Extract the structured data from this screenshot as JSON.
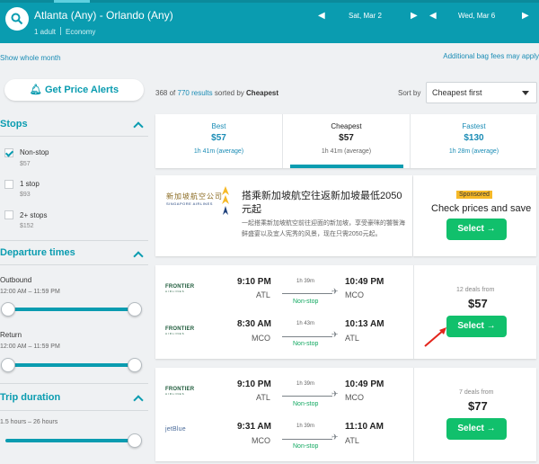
{
  "header": {
    "route": "Atlanta (Any) - Orlando (Any)",
    "travelers": "1 adult",
    "cabin": "Economy",
    "depart_date": "Sat, Mar 2",
    "return_date": "Wed, Mar 6",
    "colors": {
      "bar": "#0a9cb0"
    }
  },
  "links": {
    "show_month": "Show whole month",
    "bag_fees": "Additional bag fees may apply"
  },
  "alerts": {
    "label": "Get Price Alerts",
    "icon": "bell-icon"
  },
  "results": {
    "shown": "368",
    "total": "770",
    "of": "of",
    "results_word": "results",
    "sorted_by": "sorted by",
    "sort_key": "Cheapest",
    "sort_label": "Sort by",
    "sort_value": "Cheapest first"
  },
  "sidebar": {
    "stops": {
      "title": "Stops",
      "options": [
        {
          "label": "Non-stop",
          "price": "$57",
          "checked": true
        },
        {
          "label": "1 stop",
          "price": "$93",
          "checked": false
        },
        {
          "label": "2+ stops",
          "price": "$152",
          "checked": false
        }
      ]
    },
    "departure": {
      "title": "Departure times",
      "outbound_label": "Outbound",
      "outbound_range": "12:00 AM – 11:59 PM",
      "return_label": "Return",
      "return_range": "12:00 AM – 11:59 PM"
    },
    "duration": {
      "title": "Trip duration",
      "range": "1.5 hours – 26 hours"
    }
  },
  "tabs": [
    {
      "label": "Best",
      "price": "$57",
      "duration": "1h 41m (average)",
      "active": false
    },
    {
      "label": "Cheapest",
      "price": "$57",
      "duration": "1h 41m (average)",
      "active": true
    },
    {
      "label": "Fastest",
      "price": "$130",
      "duration": "1h 28m (average)",
      "active": false
    }
  ],
  "ad": {
    "logo_text": "新加坡航空公司",
    "logo_sub": "SINGAPORE AIRLINES",
    "title": "搭乘新加坡航空往返新加坡最低2050元起",
    "body": "一起搭乘新加坡航空前往迎面的新加坡，享受豪咪的饕餮海鲜盛宴以及宜人宪秀的风景，现在只需2050元起。",
    "sponsored": "Sponsored",
    "cta": "Check prices and save",
    "button": "Select →"
  },
  "results_list": [
    {
      "deals": "12 deals from",
      "price": "$57",
      "button": "Select →",
      "legs": [
        {
          "airline": "FRONTIER",
          "airline_sub": "AIRLINES",
          "dep_time": "9:10 PM",
          "dep_ap": "ATL",
          "duration": "1h 39m",
          "stops": "Non-stop",
          "arr_time": "10:49 PM",
          "arr_ap": "MCO"
        },
        {
          "airline": "FRONTIER",
          "airline_sub": "AIRLINES",
          "dep_time": "8:30 AM",
          "dep_ap": "MCO",
          "duration": "1h 43m",
          "stops": "Non-stop",
          "arr_time": "10:13 AM",
          "arr_ap": "ATL"
        }
      ]
    },
    {
      "deals": "7 deals from",
      "price": "$77",
      "button": "Select →",
      "legs": [
        {
          "airline": "FRONTIER",
          "airline_sub": "AIRLINES",
          "dep_time": "9:10 PM",
          "dep_ap": "ATL",
          "duration": "1h 39m",
          "stops": "Non-stop",
          "arr_time": "10:49 PM",
          "arr_ap": "MCO"
        },
        {
          "airline": "jetBlue",
          "airline_sub": "",
          "dep_time": "9:31 AM",
          "dep_ap": "MCO",
          "duration": "1h 39m",
          "stops": "Non-stop",
          "arr_time": "11:10 AM",
          "arr_ap": "ATL"
        }
      ]
    }
  ]
}
